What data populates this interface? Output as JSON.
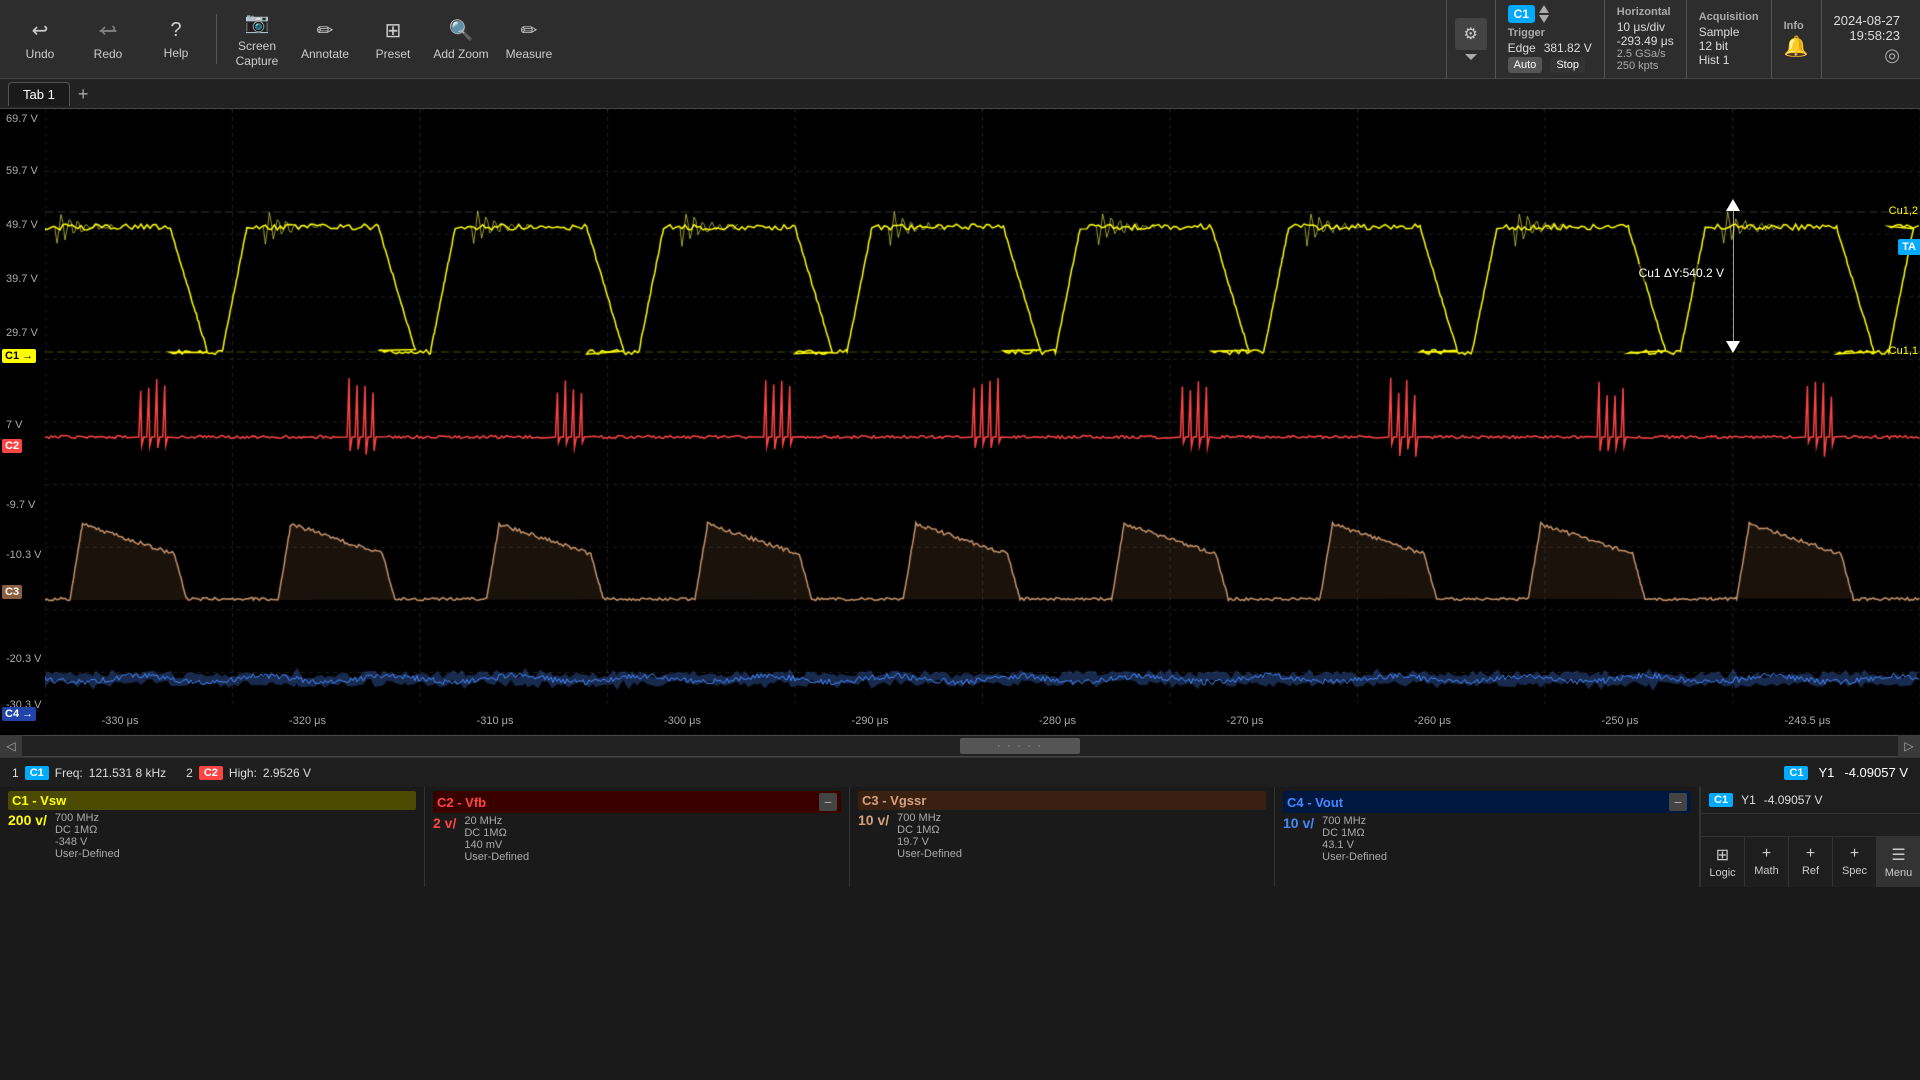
{
  "toolbar": {
    "undo_label": "Undo",
    "redo_label": "Redo",
    "help_label": "Help",
    "screen_capture_label": "Screen\nCapture",
    "annotate_label": "Annotate",
    "preset_label": "Preset",
    "add_zoom_label": "Add Zoom",
    "measure_label": "Measure"
  },
  "trigger": {
    "title": "Trigger",
    "type": "Edge",
    "voltage": "381.82 V",
    "mode": "Auto",
    "state": "Stop",
    "channel": "C1"
  },
  "horizontal": {
    "title": "Horizontal",
    "timeDiv": "10 μs/div",
    "sampleRate": "2.5 GSa/s",
    "position": "-293.49 μs",
    "samples": "250 kpts"
  },
  "acquisition": {
    "title": "Acquisition",
    "mode": "Sample",
    "bits": "12 bit",
    "hist": "Hist 1"
  },
  "info": {
    "title": "Info"
  },
  "datetime": {
    "date": "2024-08-27",
    "time": "19:58:23"
  },
  "tab": {
    "name": "Tab 1"
  },
  "scope": {
    "y_labels": [
      "69.7 V",
      "59.7 V",
      "49.7 V",
      "39.7 V",
      "29.7 V",
      "7 V",
      "-9.7 V",
      "-10.3 V",
      "-20.3 V",
      "-30.3 V"
    ],
    "time_labels": [
      "-330 μs",
      "-320 μs",
      "-310 μs",
      "-300 μs",
      "-290 μs",
      "-280 μs",
      "-270 μs",
      "-260 μs",
      "-250 μs",
      "-243.5 μs"
    ],
    "cursor_label": "Cu1 ΔY:540.2 V",
    "ta_badge": "TA",
    "cu1_top": "Cu1,2",
    "cu1_bottom": "Cu1,1"
  },
  "status": {
    "item1_num": "1",
    "item1_ch": "C1",
    "item1_label": "Freq:",
    "item1_value": "121.531 8 kHz",
    "item2_num": "2",
    "item2_ch": "C2",
    "item2_label": "High:",
    "item2_value": "2.9526 V",
    "y1_ch": "C1",
    "y1_label": "Y1",
    "y1_value": "-4.09057 V"
  },
  "channels": [
    {
      "id": "C1",
      "name": "C1 - Vsw",
      "color": "#ffff00",
      "bg": "#4a4a00",
      "voltage": "200 v/",
      "bandwidth": "700 MHz",
      "coupling": "DC 1MΩ",
      "offset": "-348 V",
      "type": "User-Defined",
      "has_minus": false
    },
    {
      "id": "C2",
      "name": "C2 - Vfb",
      "color": "#ff4444",
      "bg": "#3a0000",
      "voltage": "2 v/",
      "bandwidth": "20 MHz",
      "coupling": "DC 1MΩ",
      "offset": "140 mV",
      "type": "User-Defined",
      "has_minus": true
    },
    {
      "id": "C3",
      "name": "C3 - Vgssr",
      "color": "#d4a080",
      "bg": "#3a2010",
      "voltage": "10 v/",
      "bandwidth": "700 MHz",
      "coupling": "DC 1MΩ",
      "offset": "19.7 V",
      "type": "User-Defined",
      "has_minus": false
    },
    {
      "id": "C4",
      "name": "C4 - Vout",
      "color": "#4488ff",
      "bg": "#001840",
      "voltage": "10 v/",
      "bandwidth": "700 MHz",
      "coupling": "DC 1MΩ",
      "offset": "43.1 V",
      "type": "User-Defined",
      "has_minus": true
    }
  ],
  "right_panel": {
    "ch_indicator": "C1",
    "y1_label": "Y1",
    "y1_value": "-4.09057 V",
    "buttons": [
      {
        "label": "Logic",
        "icon": "⊞"
      },
      {
        "label": "Math",
        "icon": "+"
      },
      {
        "label": "Ref",
        "icon": "+"
      },
      {
        "label": "Spec",
        "icon": "+"
      },
      {
        "label": "Menu",
        "icon": "☰"
      }
    ]
  }
}
